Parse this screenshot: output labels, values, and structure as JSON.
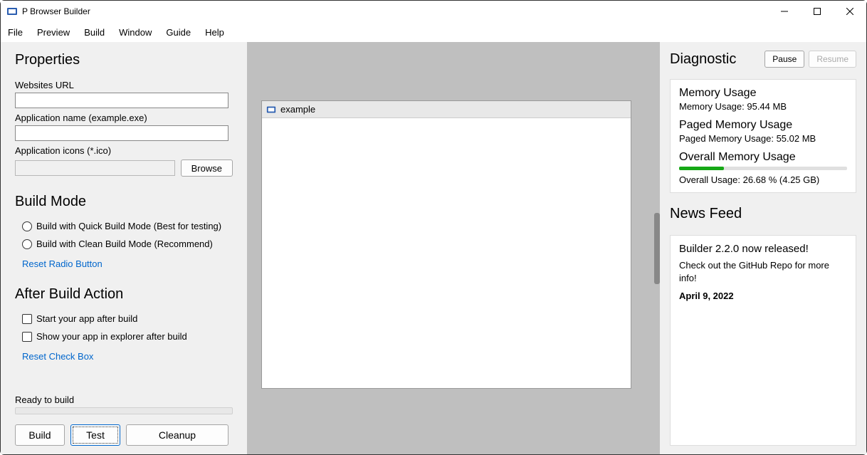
{
  "window": {
    "title": "P Browser Builder"
  },
  "menu": [
    "File",
    "Preview",
    "Build",
    "Window",
    "Guide",
    "Help"
  ],
  "left": {
    "properties_heading": "Properties",
    "url_label": "Websites URL",
    "url_value": "",
    "appname_label": "Application name (example.exe)",
    "appname_value": "",
    "icons_label": "Application icons (*.ico)",
    "icons_value": "",
    "browse_label": "Browse",
    "buildmode_heading": "Build Mode",
    "radio_quick": "Build with Quick Build Mode (Best for testing)",
    "radio_clean": "Build with Clean Build Mode (Recommend)",
    "reset_radio_link": "Reset Radio Button",
    "afterbuild_heading": "After Build Action",
    "check_start": "Start your app after build",
    "check_explorer": "Show your app in explorer after build",
    "reset_check_link": "Reset Check Box",
    "status": "Ready to build",
    "btn_build": "Build",
    "btn_test": "Test",
    "btn_cleanup": "Cleanup"
  },
  "preview": {
    "title": "example"
  },
  "right": {
    "diag_heading": "Diagnostic",
    "pause_label": "Pause",
    "resume_label": "Resume",
    "mem_heading": "Memory Usage",
    "mem_text": "Memory Usage: 95.44 MB",
    "paged_heading": "Paged Memory Usage",
    "paged_text": "Paged Memory Usage: 55.02 MB",
    "overall_heading": "Overall Memory Usage",
    "overall_text": "Overall Usage: 26.68 % (4.25 GB)",
    "overall_pct": 26.68,
    "news_heading": "News Feed",
    "news_title": "Builder 2.2.0 now released!",
    "news_body": "Check out the GitHub Repo for more info!",
    "news_date": "April 9, 2022"
  }
}
